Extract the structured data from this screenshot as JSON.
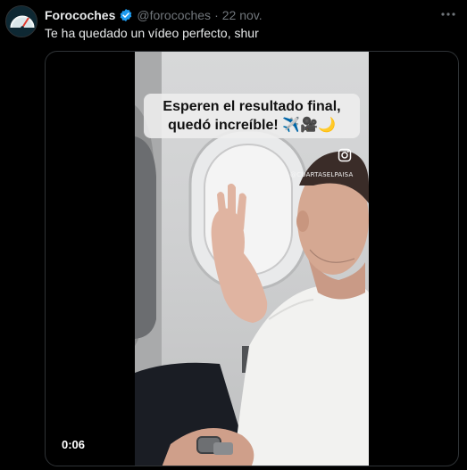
{
  "tweet": {
    "author_name": "Forocoches",
    "author_handle": "@forocoches",
    "separator": "·",
    "date": "22 nov.",
    "text": "Te ha quedado un vídeo perfecto, shur"
  },
  "media": {
    "caption_line1": "Esperen el resultado final,",
    "caption_line2": "quedó increíble! ✈️🎥🌙",
    "watermark": "@CUARTASELPAISA",
    "duration": "0:06"
  },
  "colors": {
    "verified": "#1d9bf0",
    "secondary_text": "#71767b",
    "border": "#2f3336"
  },
  "icons": [
    "avatar-speedometer-logo",
    "verified-badge-icon",
    "more-icon",
    "instagram-icon"
  ]
}
